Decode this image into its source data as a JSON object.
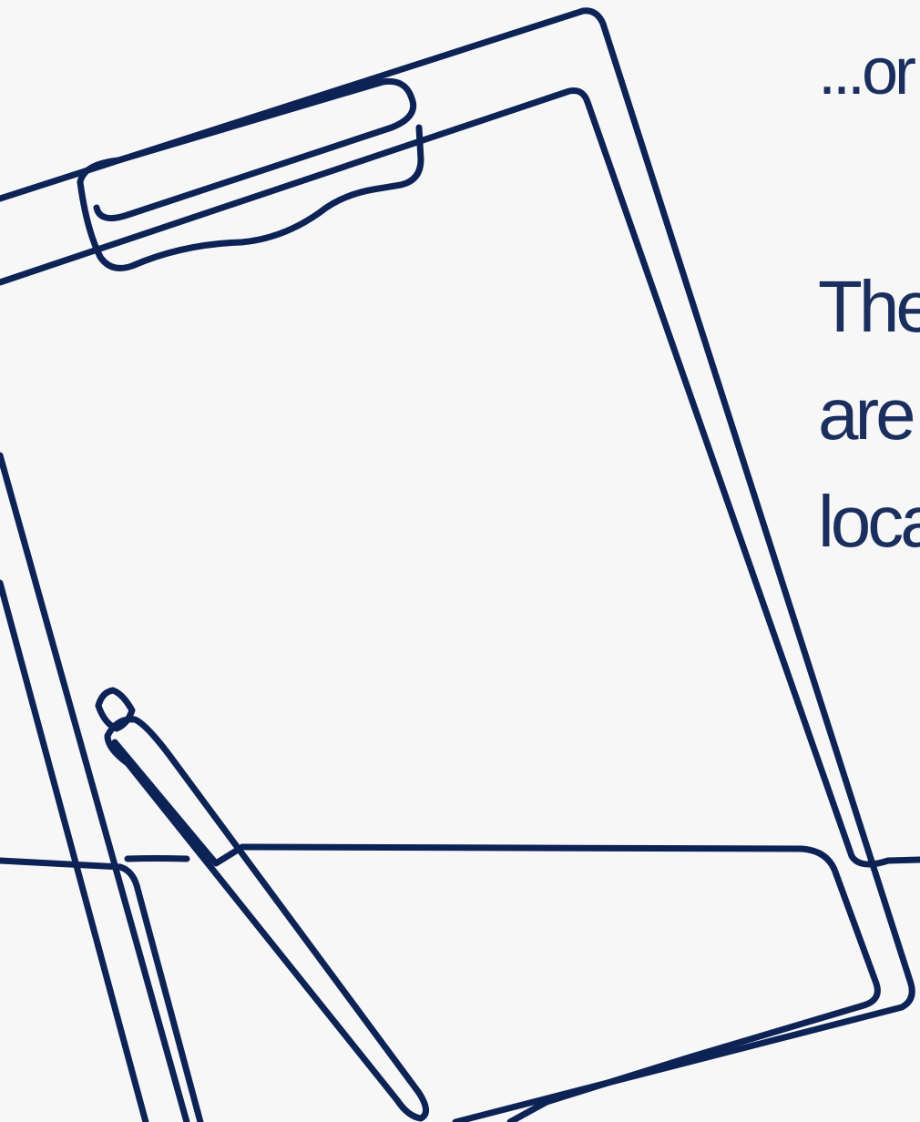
{
  "slide": {
    "lead_text": "...or",
    "body_lines": [
      "The",
      "are",
      "loca"
    ]
  },
  "illustration": {
    "icon": "clipboard-with-pen-line-art",
    "stroke_color": "#0d2356",
    "background_color": "#f7f7f8"
  },
  "colors": {
    "text": "#1b2f5e"
  }
}
